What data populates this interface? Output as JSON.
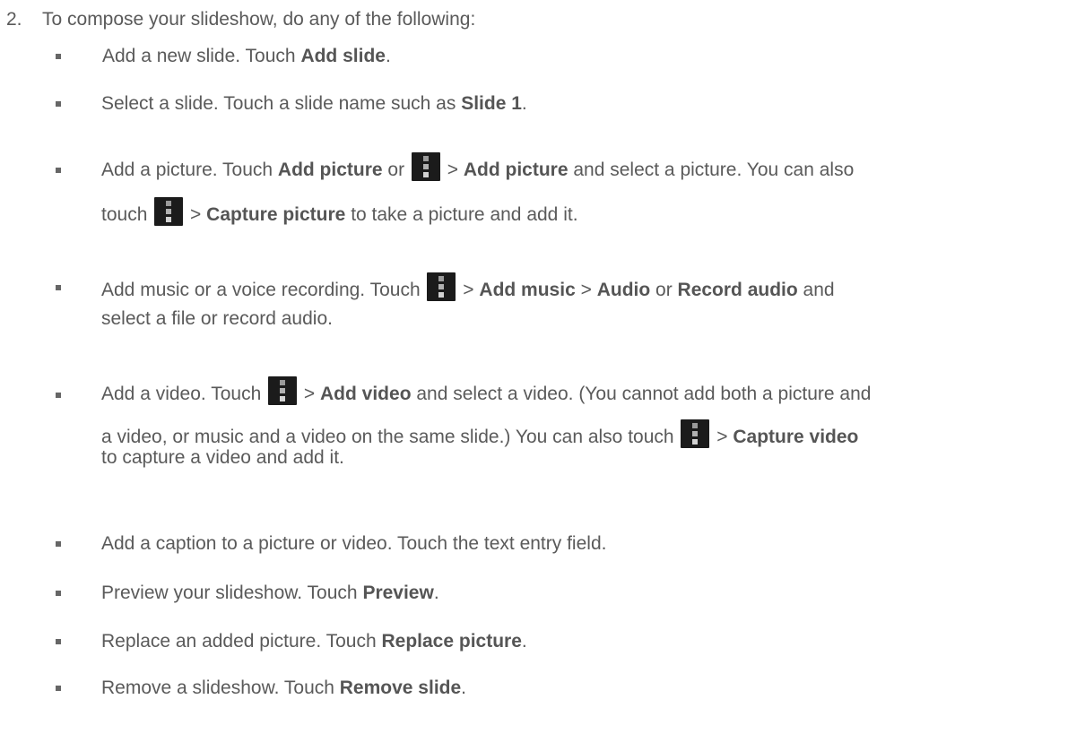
{
  "step": {
    "number": "2.",
    "text": "To compose your slideshow, do any of the following:"
  },
  "icons": {
    "menu": "overflow-menu-icon"
  },
  "b1": {
    "t1": "Add a new slide. Touch ",
    "b1": "Add slide",
    "t2": "."
  },
  "b2": {
    "t1": "Select a slide. Touch a slide name such as ",
    "b1": "Slide 1",
    "t2": "."
  },
  "b3": {
    "t1": "Add a picture. Touch ",
    "b1": "Add picture",
    "t2": " or ",
    "t3": " > ",
    "b2": "Add picture",
    "t4": " and select a picture. You can also",
    "t5": "touch ",
    "t6": " > ",
    "b3": "Capture picture",
    "t7": " to take a picture and add it."
  },
  "b4": {
    "t1": "Add music or a voice recording. Touch ",
    "t2": " > ",
    "b1": "Add music",
    "t3": " > ",
    "b2": "Audio",
    "t4": " or ",
    "b3": "Record audio",
    "t5": " and",
    "t6": "select a file or record audio."
  },
  "b5": {
    "t1": "Add a video. Touch ",
    "t2": " > ",
    "b1": "Add video",
    "t3": " and select a video. (You cannot add both a picture and",
    "t4": "a video, or music and a video on the same slide.) You can also touch ",
    "t5": " > ",
    "b2": "Capture video",
    "t6": "to capture a video and add it."
  },
  "b6": {
    "t1": "Add a caption to a picture or video. Touch the text entry field."
  },
  "b7": {
    "t1": "Preview your slideshow. Touch ",
    "b1": "Preview",
    "t2": "."
  },
  "b8": {
    "t1": "Replace an added picture. Touch ",
    "b1": "Replace picture",
    "t2": "."
  },
  "b9": {
    "t1": "Remove a slideshow. Touch ",
    "b1": "Remove slide",
    "t2": "."
  }
}
